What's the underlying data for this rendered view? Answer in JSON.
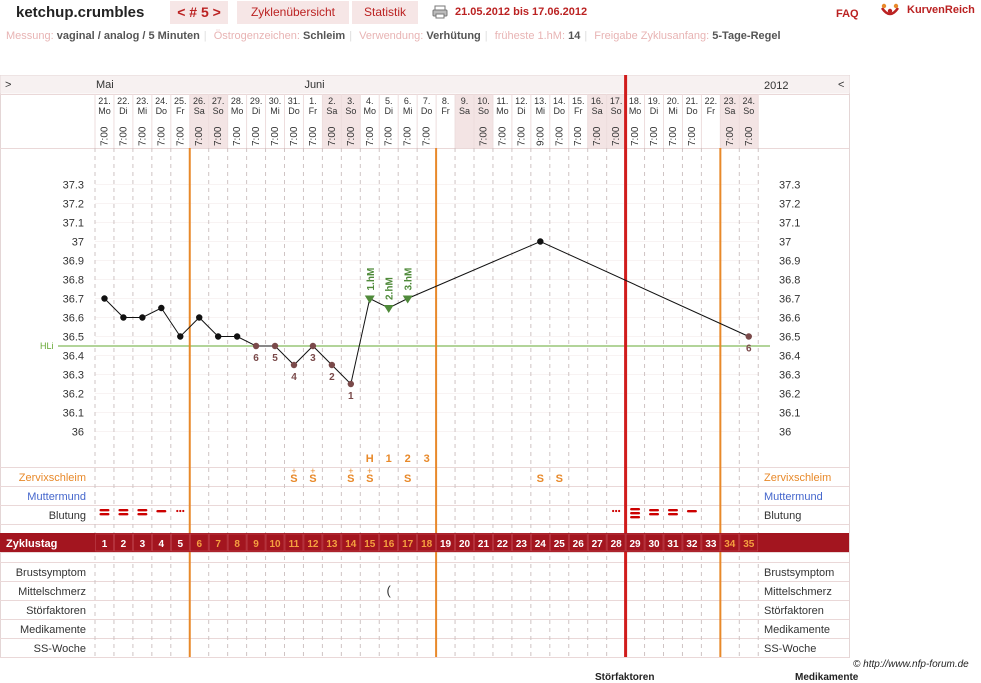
{
  "header": {
    "brand": "ketchup.crumbles",
    "cycle_nav": "< # 5 >",
    "tab_overview": "Zyklenübersicht",
    "tab_stats": "Statistik",
    "date_range": "21.05.2012 bis 17.06.2012",
    "faq": "FAQ",
    "logo_text": "KurvenReich"
  },
  "info": [
    {
      "key": "Messung:",
      "value": "vaginal / analog / 5 Minuten"
    },
    {
      "key": "Östrogenzeichen:",
      "value": "Schleim"
    },
    {
      "key": "Verwendung:",
      "value": "Verhütung"
    },
    {
      "key": "früheste 1.hM:",
      "value": "14"
    },
    {
      "key": "Freigabe Zyklusanfang:",
      "value": "5-Tage-Regel"
    }
  ],
  "chart_data": {
    "type": "line",
    "nav_left": ">",
    "nav_right": "<",
    "year_label": "2012",
    "month_labels": [
      {
        "day": 1,
        "text": "Mai"
      },
      {
        "day": 12,
        "text": "Juni"
      }
    ],
    "days": [
      {
        "date": "21.",
        "wd": "Mo",
        "time": "7:00",
        "we": false
      },
      {
        "date": "22.",
        "wd": "Di",
        "time": "7:00",
        "we": false
      },
      {
        "date": "23.",
        "wd": "Mi",
        "time": "7:00",
        "we": false
      },
      {
        "date": "24.",
        "wd": "Do",
        "time": "7:00",
        "we": false
      },
      {
        "date": "25.",
        "wd": "Fr",
        "time": "7:00",
        "we": false
      },
      {
        "date": "26.",
        "wd": "Sa",
        "time": "7:00",
        "we": true
      },
      {
        "date": "27.",
        "wd": "So",
        "time": "7:00",
        "we": true
      },
      {
        "date": "28.",
        "wd": "Mo",
        "time": "7:00",
        "we": false
      },
      {
        "date": "29.",
        "wd": "Di",
        "time": "7:00",
        "we": false
      },
      {
        "date": "30.",
        "wd": "Mi",
        "time": "7:00",
        "we": false
      },
      {
        "date": "31.",
        "wd": "Do",
        "time": "7:00",
        "we": false
      },
      {
        "date": "1.",
        "wd": "Fr",
        "time": "7:00",
        "we": false
      },
      {
        "date": "2.",
        "wd": "Sa",
        "time": "7:00",
        "we": true
      },
      {
        "date": "3.",
        "wd": "So",
        "time": "7:00",
        "we": true
      },
      {
        "date": "4.",
        "wd": "Mo",
        "time": "7:00",
        "we": false
      },
      {
        "date": "5.",
        "wd": "Di",
        "time": "7:00",
        "we": false
      },
      {
        "date": "6.",
        "wd": "Mi",
        "time": "7:00",
        "we": false
      },
      {
        "date": "7.",
        "wd": "Do",
        "time": "7:00",
        "we": false
      },
      {
        "date": "8.",
        "wd": "Fr",
        "time": "",
        "we": false
      },
      {
        "date": "9.",
        "wd": "Sa",
        "time": "",
        "we": true
      },
      {
        "date": "10.",
        "wd": "So",
        "time": "7:00",
        "we": true
      },
      {
        "date": "11.",
        "wd": "Mo",
        "time": "7:00",
        "we": false
      },
      {
        "date": "12.",
        "wd": "Di",
        "time": "7:00",
        "we": false
      },
      {
        "date": "13.",
        "wd": "Mi",
        "time": "9:00",
        "we": false
      },
      {
        "date": "14.",
        "wd": "Do",
        "time": "7:00",
        "we": false
      },
      {
        "date": "15.",
        "wd": "Fr",
        "time": "7:00",
        "we": false
      },
      {
        "date": "16.",
        "wd": "Sa",
        "time": "7:00",
        "we": true
      },
      {
        "date": "17.",
        "wd": "So",
        "time": "7:00",
        "we": true
      },
      {
        "date": "18.",
        "wd": "Mo",
        "time": "7:00",
        "we": false
      },
      {
        "date": "19.",
        "wd": "Di",
        "time": "7:00",
        "we": false
      },
      {
        "date": "20.",
        "wd": "Mi",
        "time": "7:00",
        "we": false
      },
      {
        "date": "21.",
        "wd": "Do",
        "time": "7:00",
        "we": false
      },
      {
        "date": "22.",
        "wd": "Fr",
        "time": "",
        "we": false
      },
      {
        "date": "23.",
        "wd": "Sa",
        "time": "7:00",
        "we": true
      },
      {
        "date": "24.",
        "wd": "So",
        "time": "7:00",
        "we": true
      }
    ],
    "y_ticks": [
      "37.3",
      "37.2",
      "37.1",
      "37",
      "36.9",
      "36.8",
      "36.7",
      "36.6",
      "36.5",
      "36.4",
      "36.3",
      "36.2",
      "36.1",
      "36"
    ],
    "ylim": [
      36.0,
      37.3
    ],
    "hili_label": "HLi",
    "hili_value": 36.45,
    "temps": [
      {
        "day": 1,
        "t": 36.7
      },
      {
        "day": 2,
        "t": 36.6
      },
      {
        "day": 3,
        "t": 36.6
      },
      {
        "day": 4,
        "t": 36.65
      },
      {
        "day": 5,
        "t": 36.5
      },
      {
        "day": 6,
        "t": 36.6
      },
      {
        "day": 7,
        "t": 36.5
      },
      {
        "day": 8,
        "t": 36.5
      },
      {
        "day": 9,
        "t": 36.45,
        "label": "6"
      },
      {
        "day": 10,
        "t": 36.45,
        "label": "5"
      },
      {
        "day": 11,
        "t": 36.35,
        "label": "4"
      },
      {
        "day": 12,
        "t": 36.45,
        "label": "3"
      },
      {
        "day": 13,
        "t": 36.35,
        "label": "2"
      },
      {
        "day": 14,
        "t": 36.25,
        "label": "1"
      },
      {
        "day": 15,
        "t": 36.7,
        "hm": "1.hM"
      },
      {
        "day": 16,
        "t": 36.65,
        "hm": "2.hM"
      },
      {
        "day": 17,
        "t": 36.7,
        "hm": "3.hM"
      },
      {
        "day": 24,
        "t": 37.0
      },
      {
        "day": 35,
        "t": 36.5,
        "label": "6"
      }
    ],
    "mucus_eval": [
      {
        "day": 15,
        "text": "H"
      },
      {
        "day": 16,
        "text": "1"
      },
      {
        "day": 17,
        "text": "2"
      },
      {
        "day": 18,
        "text": "3"
      }
    ],
    "mucus_marks": [
      {
        "day": 11,
        "text": "S",
        "plus": true
      },
      {
        "day": 12,
        "text": "S",
        "plus": true
      },
      {
        "day": 14,
        "text": "S",
        "plus": true
      },
      {
        "day": 15,
        "text": "S",
        "plus": true
      },
      {
        "day": 17,
        "text": "S",
        "plus": false
      },
      {
        "day": 24,
        "text": "S",
        "plus": false
      },
      {
        "day": 25,
        "text": "S",
        "plus": false
      }
    ],
    "bleeding": [
      {
        "day": 1,
        "level": "strong"
      },
      {
        "day": 2,
        "level": "strong"
      },
      {
        "day": 3,
        "level": "strong"
      },
      {
        "day": 4,
        "level": "medium"
      },
      {
        "day": 5,
        "level": "spotting"
      },
      {
        "day": 28,
        "level": "spotting"
      },
      {
        "day": 29,
        "level": "very-strong"
      },
      {
        "day": 30,
        "level": "strong"
      },
      {
        "day": 31,
        "level": "strong"
      },
      {
        "day": 32,
        "level": "medium"
      }
    ],
    "cycle_days_label": "Zyklustag",
    "cycle_days": [
      "1",
      "2",
      "3",
      "4",
      "5",
      "6",
      "7",
      "8",
      "9",
      "10",
      "11",
      "12",
      "13",
      "14",
      "15",
      "16",
      "17",
      "18",
      "19",
      "20",
      "21",
      "22",
      "23",
      "24",
      "25",
      "26",
      "27",
      "28",
      "29",
      "30",
      "31",
      "32",
      "33",
      "34",
      "35"
    ],
    "orange_day_ranges": [
      [
        6,
        18
      ],
      [
        34,
        35
      ]
    ],
    "row_labels": {
      "zervix": "Zervixschleim",
      "muttermund": "Muttermund",
      "blutung": "Blutung",
      "brust": "Brustsymptom",
      "mittel": "Mittelschmerz",
      "stoer": "Störfaktoren",
      "medi": "Medikamente",
      "ss": "SS-Woche"
    },
    "mittelschmerz_day": 16,
    "mittelschmerz_symbol": "(",
    "orange_lines_after_day": [
      5,
      18,
      33
    ],
    "red_line_after_day": 28
  },
  "footer": {
    "copyright": "© http://www.nfp-forum.de",
    "cut1": "Störfaktoren",
    "cut2": "Medikamente"
  },
  "colors": {
    "accent": "#b22222",
    "orange": "#e8892a",
    "blue": "#4466cc",
    "weekend": "#f3e4e4",
    "grid": "#f8f3f3",
    "band": "#a3151f"
  }
}
